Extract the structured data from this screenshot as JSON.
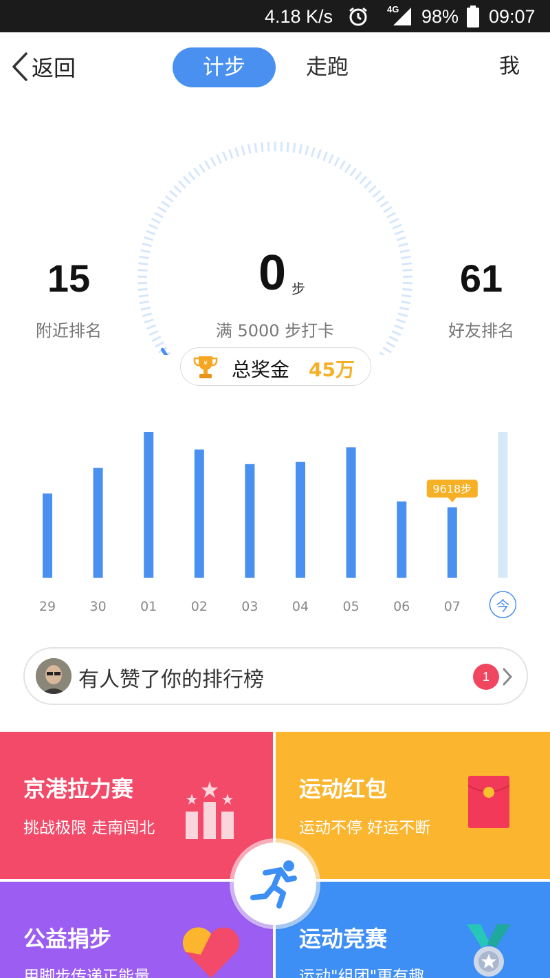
{
  "status_bar": {
    "speed": "4.18 K/s",
    "network": "4G",
    "battery": "98%",
    "time": "09:07"
  },
  "header": {
    "back_label": "返回",
    "tabs": [
      {
        "label": "计步",
        "active": true
      },
      {
        "label": "走跑",
        "active": false
      }
    ],
    "me_label": "我"
  },
  "stats": {
    "nearby_rank": "15",
    "nearby_label": "附近排名",
    "steps": "0",
    "steps_unit": "步",
    "goal_text": "满 5000 步打卡",
    "friend_rank": "61",
    "friend_label": "好友排名",
    "progress": 0.0
  },
  "prize": {
    "label": "总奖金",
    "amount": "45万",
    "icon": "trophy-icon"
  },
  "chart_data": {
    "type": "bar",
    "categories": [
      "29",
      "30",
      "01",
      "02",
      "03",
      "04",
      "05",
      "06",
      "07",
      "今"
    ],
    "values": [
      11500,
      15000,
      19900,
      17500,
      15500,
      15800,
      17800,
      10400,
      9618,
      19900
    ],
    "highlight": {
      "index": 8,
      "label": "9618步"
    },
    "today_index": 9,
    "colors": {
      "bar": "#4a90f0",
      "today": "#d8e8fb",
      "tooltip": "#f5b025"
    }
  },
  "like_banner": {
    "text": "有人赞了你的排行榜",
    "badge": "1"
  },
  "cards": [
    {
      "title": "京港拉力赛",
      "subtitle": "挑战极限 走南闯北",
      "color": "#f24a68",
      "icon": "podium-stars-icon"
    },
    {
      "title": "运动红包",
      "subtitle": "运动不停 好运不断",
      "color": "#fbb52e",
      "icon": "red-envelope-icon"
    },
    {
      "title": "公益捐步",
      "subtitle": "用脚步传递正能量",
      "color": "#9b5df2",
      "icon": "heart-icon"
    },
    {
      "title": "运动竞赛",
      "subtitle": "运动\"组团\"更有趣",
      "color": "#3d8ef5",
      "icon": "medal-icon"
    }
  ]
}
